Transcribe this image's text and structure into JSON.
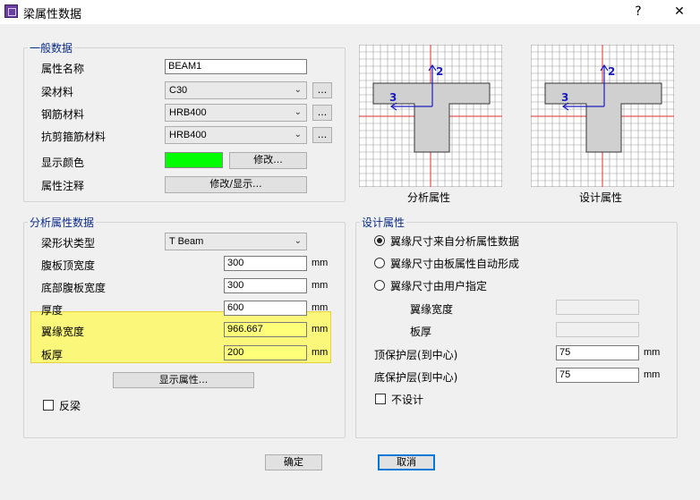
{
  "window": {
    "title": "梁属性数据",
    "help_label": "?",
    "close_label": "✕"
  },
  "general": {
    "legend": "一般数据",
    "name_label": "属性名称",
    "name_value": "BEAM1",
    "material_label": "梁材料",
    "material_value": "C30",
    "rebar_label": "钢筋材料",
    "rebar_value": "HRB400",
    "stirrup_label": "抗剪箍筋材料",
    "stirrup_value": "HRB400",
    "color_label": "显示颜色",
    "color_value": "#00ff00",
    "color_button": "修改...",
    "note_label": "属性注释",
    "note_button": "修改/显示...",
    "dots_label": "..."
  },
  "diagrams": {
    "analysis_caption": "分析属性",
    "design_caption": "设计属性",
    "axis_2": "2",
    "axis_3": "3"
  },
  "analysis": {
    "legend": "分析属性数据",
    "shape_label": "梁形状类型",
    "shape_value": "T Beam",
    "top_web_label": "腹板顶宽度",
    "top_web_value": "300",
    "bottom_web_label": "底部腹板宽度",
    "bottom_web_value": "300",
    "depth_label": "厚度",
    "depth_value": "600",
    "flange_width_label": "翼缘宽度",
    "flange_width_value": "966.667",
    "slab_label": "板厚",
    "slab_value": "200",
    "unit": "mm",
    "show_button": "显示属性...",
    "reverse_label": "反梁"
  },
  "design": {
    "legend": "设计属性",
    "opt1": "翼缘尺寸来自分析属性数据",
    "opt2": "翼缘尺寸由板属性自动形成",
    "opt3": "翼缘尺寸由用户指定",
    "flange_width_label": "翼缘宽度",
    "slab_label": "板厚",
    "top_cover_label": "顶保护层(到中心)",
    "top_cover_value": "75",
    "bottom_cover_label": "底保护层(到中心)",
    "bottom_cover_value": "75",
    "unit": "mm",
    "no_design_label": "不设计"
  },
  "footer": {
    "ok": "确定",
    "cancel": "取消"
  }
}
